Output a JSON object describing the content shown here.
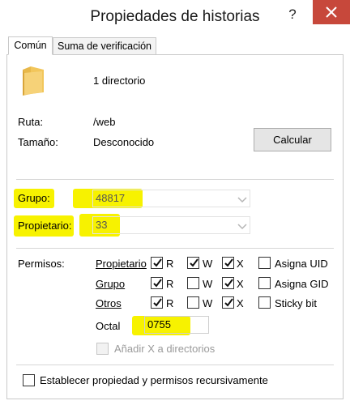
{
  "window": {
    "title": "Propiedades de historias",
    "help_glyph": "?",
    "close_label": "close"
  },
  "tabs": [
    {
      "label": "Común",
      "active": true
    },
    {
      "label": "Suma de verificación",
      "active": false
    }
  ],
  "info": {
    "folder_icon": "folder-icon",
    "dir_count": "1 directorio",
    "ruta_label": "Ruta:",
    "ruta_value": "/web",
    "tamano_label": "Tamaño:",
    "tamano_value": "Desconocido",
    "calcular_label": "Calcular"
  },
  "ownership": {
    "grupo_label": "Grupo:",
    "grupo_value": "48817",
    "propietario_label": "Propietario:",
    "propietario_value": "33"
  },
  "permissions": {
    "label": "Permisos:",
    "rows": [
      {
        "label": "Propietario",
        "r": true,
        "w": true,
        "x": true
      },
      {
        "label": "Grupo",
        "r": true,
        "w": false,
        "x": true
      },
      {
        "label": "Otros",
        "r": true,
        "w": false,
        "x": true
      }
    ],
    "col_labels": {
      "r": "R",
      "w": "W",
      "x": "X"
    },
    "special": [
      {
        "label": "Asigna UID",
        "checked": false
      },
      {
        "label": "Asigna GID",
        "checked": false
      },
      {
        "label": "Sticky bit",
        "checked": false
      }
    ],
    "octal_label": "Octal",
    "octal_value": "0755",
    "add_x_label": "Añadir X a directorios",
    "add_x_checked": false
  },
  "recursive": {
    "label": "Establecer propiedad y permisos recursivamente",
    "checked": false
  },
  "colors": {
    "highlight": "#f7f200",
    "close_red": "#c7483b",
    "folder": "#f2c65b"
  }
}
